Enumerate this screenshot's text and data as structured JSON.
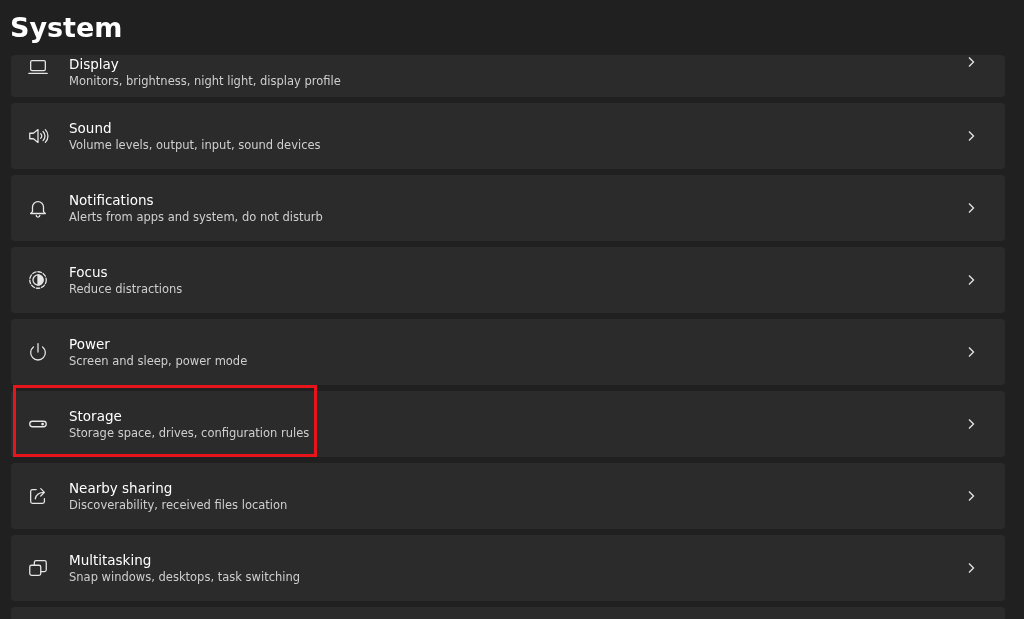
{
  "header": {
    "title": "System"
  },
  "items": [
    {
      "title": "Display",
      "subtitle": "Monitors, brightness, night light, display profile",
      "highlighted": false
    },
    {
      "title": "Sound",
      "subtitle": "Volume levels, output, input, sound devices",
      "highlighted": false
    },
    {
      "title": "Notifications",
      "subtitle": "Alerts from apps and system, do not disturb",
      "highlighted": false
    },
    {
      "title": "Focus",
      "subtitle": "Reduce distractions",
      "highlighted": false
    },
    {
      "title": "Power",
      "subtitle": "Screen and sleep, power mode",
      "highlighted": false
    },
    {
      "title": "Storage",
      "subtitle": "Storage space, drives, configuration rules",
      "highlighted": true
    },
    {
      "title": "Nearby sharing",
      "subtitle": "Discoverability, received files location",
      "highlighted": false
    },
    {
      "title": "Multitasking",
      "subtitle": "Snap windows, desktops, task switching",
      "highlighted": false
    }
  ]
}
